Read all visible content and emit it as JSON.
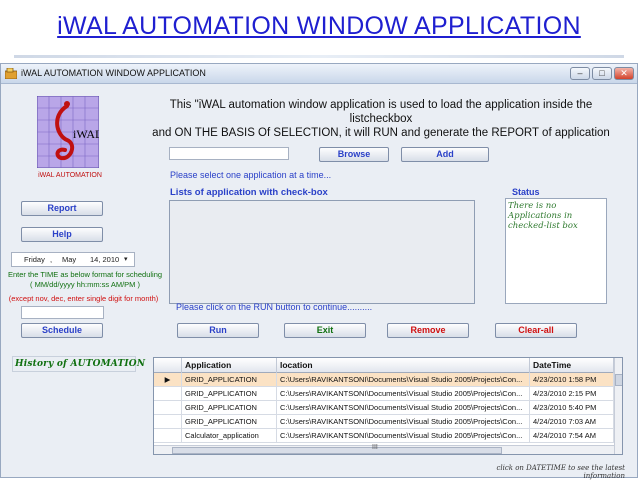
{
  "slide": {
    "title": "iWAL  AUTOMATION  WINDOW  APPLICATION"
  },
  "window": {
    "title": "iWAL AUTOMATION WINDOW APPLICATION",
    "controls": {
      "minimize": "–",
      "maximize": "□",
      "close": "✕"
    }
  },
  "logo": {
    "text": "iWAL",
    "caption": "iWAL AUTOMATION"
  },
  "description": {
    "line1": "This \"iWAL automation window application is used to load the application inside the listcheckbox",
    "line2": "and ON THE BASIS Of SELECTION, it will RUN and generate the REPORT of application"
  },
  "buttons": {
    "browse": "Browse",
    "add": "Add",
    "report": "Report",
    "help": "Help",
    "schedule": "Schedule",
    "run": "Run",
    "exit": "Exit",
    "remove": "Remove",
    "clear_all": "Clear-all"
  },
  "hints": {
    "select_one": "Please select one application at a time...",
    "list_heading": "Lists of application with check-box",
    "run_hint": "Please click on the RUN button to continue..........",
    "footer": "click on DATETIME to see the latest information"
  },
  "status": {
    "label": "Status",
    "message": "There is no Applications in checked-list box"
  },
  "schedule_panel": {
    "date_picker": {
      "day": "Friday",
      "sep": ",",
      "month": "May",
      "date": "14, 2010",
      "arrow": "▾"
    },
    "instruction": "Enter the TIME as below format for scheduling",
    "format": "( MM/dd/yyyy hh:mm:ss AM/PM )",
    "except_note": "(except nov, dec, enter single digit for month)"
  },
  "history": {
    "label": "History of AUTOMATION",
    "columns": [
      "Application",
      "location",
      "DateTime"
    ],
    "rows": [
      {
        "selected": true,
        "marker": "▶",
        "app": "GRID_APPLICATION",
        "location": "C:\\Users\\RAVIKANTSONI\\Documents\\Visual Studio 2005\\Projects\\Con...",
        "datetime": "4/23/2010 1:58 PM"
      },
      {
        "selected": false,
        "marker": "",
        "app": "GRID_APPLICATION",
        "location": "C:\\Users\\RAVIKANTSONI\\Documents\\Visual Studio 2005\\Projects\\Con...",
        "datetime": "4/23/2010 2:15 PM"
      },
      {
        "selected": false,
        "marker": "",
        "app": "GRID_APPLICATION",
        "location": "C:\\Users\\RAVIKANTSONI\\Documents\\Visual Studio 2005\\Projects\\Con...",
        "datetime": "4/23/2010 5:40 PM"
      },
      {
        "selected": false,
        "marker": "",
        "app": "GRID_APPLICATION",
        "location": "C:\\Users\\RAVIKANTSONI\\Documents\\Visual Studio 2005\\Projects\\Con...",
        "datetime": "4/24/2010 7:03 AM"
      },
      {
        "selected": false,
        "marker": "",
        "app": "Calculator_application",
        "location": "C:\\Users\\RAVIKANTSONI\\Documents\\Visual Studio 2005\\Projects\\Con...",
        "datetime": "4/24/2010 7:54 AM"
      }
    ],
    "hscroll_label": "III"
  },
  "colors": {
    "title_blue": "#1f1fd0",
    "label_blue": "#2b41c8",
    "accent_red": "#d01010",
    "accent_green": "#107010",
    "selected_row": "#fbe2c4"
  }
}
